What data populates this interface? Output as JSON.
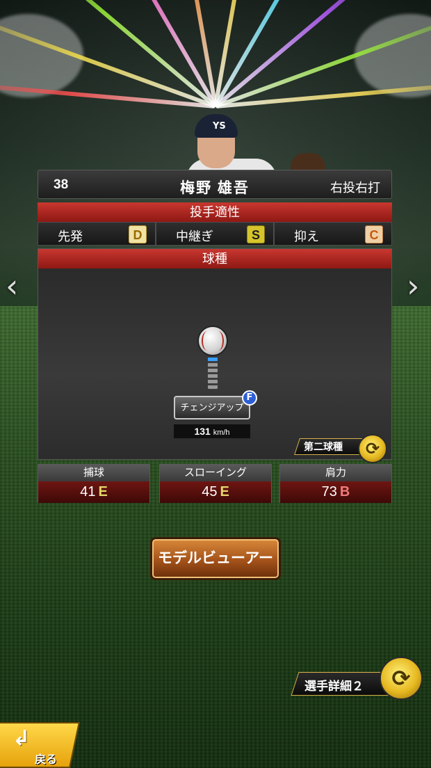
{
  "player": {
    "number": "38",
    "name": "梅野 雄吾",
    "handedness": "右投右打",
    "cap_logo": "YS"
  },
  "aptitude": {
    "title": "投手適性",
    "items": [
      {
        "label": "先発",
        "grade": "D",
        "color": "#e4b23a"
      },
      {
        "label": "中継ぎ",
        "grade": "S",
        "color": "#e9d23c"
      },
      {
        "label": "抑え",
        "grade": "C",
        "color": "#e4822e"
      }
    ]
  },
  "pitches": {
    "title": "球種",
    "name": "チェンジアップ",
    "badge": "F",
    "speed": "131",
    "speed_unit": "km/h",
    "second_label": "第二球種"
  },
  "stats": [
    {
      "label": "捕球",
      "value": "41",
      "grade": "E",
      "color": "#e3d76a"
    },
    {
      "label": "スローイング",
      "value": "45",
      "grade": "E",
      "color": "#e3d76a"
    },
    {
      "label": "肩力",
      "value": "73",
      "grade": "B",
      "color": "#f07b7b"
    }
  ],
  "buttons": {
    "model_viewer": "モデルビューアー",
    "detail2": "選手詳細２",
    "back": "戻る"
  },
  "icons": {
    "prev": "‹",
    "next": "›",
    "cycle": "⟳",
    "back_arrow": "↲"
  }
}
